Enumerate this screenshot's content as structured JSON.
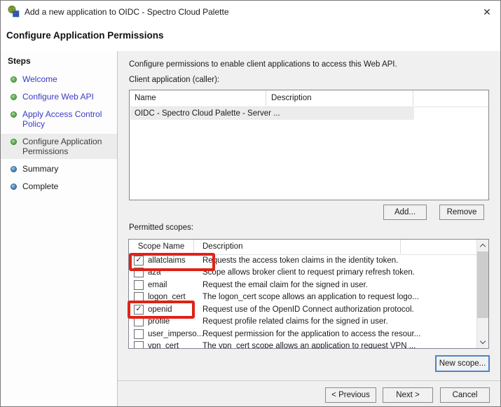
{
  "window": {
    "title": "Add a new application to OIDC - Spectro Cloud Palette"
  },
  "icons": {
    "close": "✕",
    "check": "✓",
    "app_icon": "adfs-application-icon",
    "scroll_up": "chevron-up",
    "scroll_down": "chevron-down"
  },
  "header": {
    "title": "Configure Application Permissions"
  },
  "sidebar": {
    "heading": "Steps",
    "items": [
      {
        "label": "Welcome",
        "state": "completed"
      },
      {
        "label": "Configure Web API",
        "state": "completed"
      },
      {
        "label": "Apply Access Control Policy",
        "state": "completed"
      },
      {
        "label": "Configure Application Permissions",
        "state": "current"
      },
      {
        "label": "Summary",
        "state": "upcoming"
      },
      {
        "label": "Complete",
        "state": "upcoming"
      }
    ]
  },
  "main": {
    "intro": "Configure permissions to enable client applications to access this Web API.",
    "client": {
      "label": "Client application (caller):",
      "columns": [
        "Name",
        "Description"
      ],
      "rows": [
        {
          "name": "OIDC - Spectro Cloud Palette - Server ...",
          "description": ""
        }
      ]
    },
    "add_button": "Add...",
    "remove_button": "Remove",
    "scopes": {
      "label": "Permitted scopes:",
      "columns": [
        "Scope Name",
        "Description"
      ],
      "rows": [
        {
          "name": "allatclaims",
          "checked": true,
          "check": "✓",
          "description": "Requests the access token claims in the identity token.",
          "annotated": true
        },
        {
          "name": "aza",
          "checked": false,
          "check": "",
          "description": "Scope allows broker client to request primary refresh token."
        },
        {
          "name": "email",
          "checked": false,
          "check": "",
          "description": "Request the email claim for the signed in user."
        },
        {
          "name": "logon_cert",
          "checked": false,
          "check": "",
          "description": "The logon_cert scope allows an application to request logo..."
        },
        {
          "name": "openid",
          "checked": true,
          "check": "✓",
          "description": "Request use of the OpenID Connect authorization protocol.",
          "annotated": true
        },
        {
          "name": "profile",
          "checked": false,
          "check": "",
          "description": "Request profile related claims for the signed in user."
        },
        {
          "name": "user_imperso...",
          "checked": false,
          "check": "",
          "description": "Request permission for the application to access the resour..."
        },
        {
          "name": "vpn_cert",
          "checked": false,
          "check": "",
          "description": "The vpn_cert scope allows an application to request VPN ..."
        }
      ]
    },
    "new_scope_button": "New scope..."
  },
  "footer": {
    "previous": "< Previous",
    "next": "Next >",
    "cancel": "Cancel"
  },
  "colors": {
    "annotation_red": "#df2317",
    "step_link": "#3a3ac8",
    "bullet_completed_green": "#55a546",
    "bullet_upcoming_blue": "#3d7bb5",
    "focus_border": "#4a86c8",
    "selection_gray": "#ececec"
  }
}
